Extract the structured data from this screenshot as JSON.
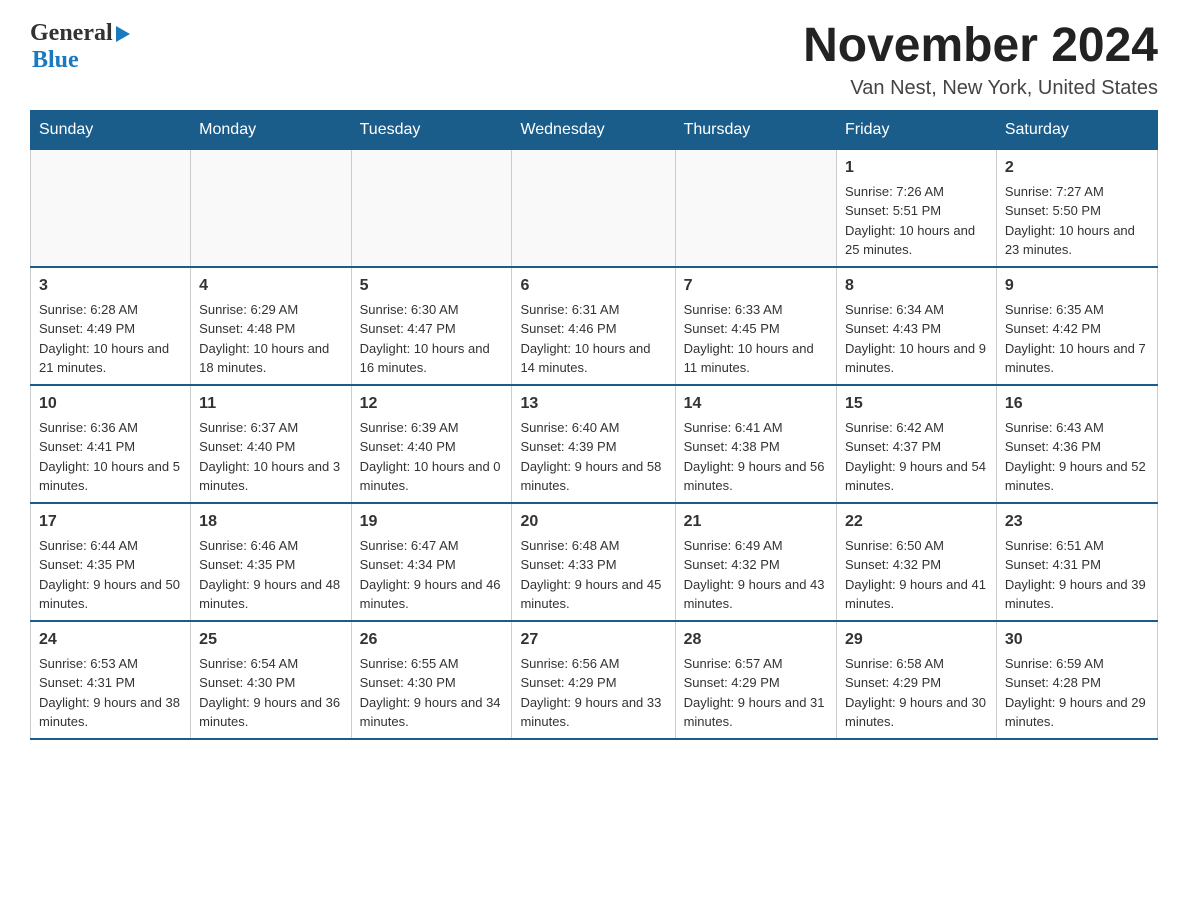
{
  "logo": {
    "general": "General",
    "blue": "Blue",
    "arrow_color": "#1a7abf"
  },
  "title": {
    "month_year": "November 2024",
    "location": "Van Nest, New York, United States"
  },
  "header_days": [
    "Sunday",
    "Monday",
    "Tuesday",
    "Wednesday",
    "Thursday",
    "Friday",
    "Saturday"
  ],
  "weeks": [
    [
      {
        "day": "",
        "sunrise": "",
        "sunset": "",
        "daylight": ""
      },
      {
        "day": "",
        "sunrise": "",
        "sunset": "",
        "daylight": ""
      },
      {
        "day": "",
        "sunrise": "",
        "sunset": "",
        "daylight": ""
      },
      {
        "day": "",
        "sunrise": "",
        "sunset": "",
        "daylight": ""
      },
      {
        "day": "",
        "sunrise": "",
        "sunset": "",
        "daylight": ""
      },
      {
        "day": "1",
        "sunrise": "Sunrise: 7:26 AM",
        "sunset": "Sunset: 5:51 PM",
        "daylight": "Daylight: 10 hours and 25 minutes."
      },
      {
        "day": "2",
        "sunrise": "Sunrise: 7:27 AM",
        "sunset": "Sunset: 5:50 PM",
        "daylight": "Daylight: 10 hours and 23 minutes."
      }
    ],
    [
      {
        "day": "3",
        "sunrise": "Sunrise: 6:28 AM",
        "sunset": "Sunset: 4:49 PM",
        "daylight": "Daylight: 10 hours and 21 minutes."
      },
      {
        "day": "4",
        "sunrise": "Sunrise: 6:29 AM",
        "sunset": "Sunset: 4:48 PM",
        "daylight": "Daylight: 10 hours and 18 minutes."
      },
      {
        "day": "5",
        "sunrise": "Sunrise: 6:30 AM",
        "sunset": "Sunset: 4:47 PM",
        "daylight": "Daylight: 10 hours and 16 minutes."
      },
      {
        "day": "6",
        "sunrise": "Sunrise: 6:31 AM",
        "sunset": "Sunset: 4:46 PM",
        "daylight": "Daylight: 10 hours and 14 minutes."
      },
      {
        "day": "7",
        "sunrise": "Sunrise: 6:33 AM",
        "sunset": "Sunset: 4:45 PM",
        "daylight": "Daylight: 10 hours and 11 minutes."
      },
      {
        "day": "8",
        "sunrise": "Sunrise: 6:34 AM",
        "sunset": "Sunset: 4:43 PM",
        "daylight": "Daylight: 10 hours and 9 minutes."
      },
      {
        "day": "9",
        "sunrise": "Sunrise: 6:35 AM",
        "sunset": "Sunset: 4:42 PM",
        "daylight": "Daylight: 10 hours and 7 minutes."
      }
    ],
    [
      {
        "day": "10",
        "sunrise": "Sunrise: 6:36 AM",
        "sunset": "Sunset: 4:41 PM",
        "daylight": "Daylight: 10 hours and 5 minutes."
      },
      {
        "day": "11",
        "sunrise": "Sunrise: 6:37 AM",
        "sunset": "Sunset: 4:40 PM",
        "daylight": "Daylight: 10 hours and 3 minutes."
      },
      {
        "day": "12",
        "sunrise": "Sunrise: 6:39 AM",
        "sunset": "Sunset: 4:40 PM",
        "daylight": "Daylight: 10 hours and 0 minutes."
      },
      {
        "day": "13",
        "sunrise": "Sunrise: 6:40 AM",
        "sunset": "Sunset: 4:39 PM",
        "daylight": "Daylight: 9 hours and 58 minutes."
      },
      {
        "day": "14",
        "sunrise": "Sunrise: 6:41 AM",
        "sunset": "Sunset: 4:38 PM",
        "daylight": "Daylight: 9 hours and 56 minutes."
      },
      {
        "day": "15",
        "sunrise": "Sunrise: 6:42 AM",
        "sunset": "Sunset: 4:37 PM",
        "daylight": "Daylight: 9 hours and 54 minutes."
      },
      {
        "day": "16",
        "sunrise": "Sunrise: 6:43 AM",
        "sunset": "Sunset: 4:36 PM",
        "daylight": "Daylight: 9 hours and 52 minutes."
      }
    ],
    [
      {
        "day": "17",
        "sunrise": "Sunrise: 6:44 AM",
        "sunset": "Sunset: 4:35 PM",
        "daylight": "Daylight: 9 hours and 50 minutes."
      },
      {
        "day": "18",
        "sunrise": "Sunrise: 6:46 AM",
        "sunset": "Sunset: 4:35 PM",
        "daylight": "Daylight: 9 hours and 48 minutes."
      },
      {
        "day": "19",
        "sunrise": "Sunrise: 6:47 AM",
        "sunset": "Sunset: 4:34 PM",
        "daylight": "Daylight: 9 hours and 46 minutes."
      },
      {
        "day": "20",
        "sunrise": "Sunrise: 6:48 AM",
        "sunset": "Sunset: 4:33 PM",
        "daylight": "Daylight: 9 hours and 45 minutes."
      },
      {
        "day": "21",
        "sunrise": "Sunrise: 6:49 AM",
        "sunset": "Sunset: 4:32 PM",
        "daylight": "Daylight: 9 hours and 43 minutes."
      },
      {
        "day": "22",
        "sunrise": "Sunrise: 6:50 AM",
        "sunset": "Sunset: 4:32 PM",
        "daylight": "Daylight: 9 hours and 41 minutes."
      },
      {
        "day": "23",
        "sunrise": "Sunrise: 6:51 AM",
        "sunset": "Sunset: 4:31 PM",
        "daylight": "Daylight: 9 hours and 39 minutes."
      }
    ],
    [
      {
        "day": "24",
        "sunrise": "Sunrise: 6:53 AM",
        "sunset": "Sunset: 4:31 PM",
        "daylight": "Daylight: 9 hours and 38 minutes."
      },
      {
        "day": "25",
        "sunrise": "Sunrise: 6:54 AM",
        "sunset": "Sunset: 4:30 PM",
        "daylight": "Daylight: 9 hours and 36 minutes."
      },
      {
        "day": "26",
        "sunrise": "Sunrise: 6:55 AM",
        "sunset": "Sunset: 4:30 PM",
        "daylight": "Daylight: 9 hours and 34 minutes."
      },
      {
        "day": "27",
        "sunrise": "Sunrise: 6:56 AM",
        "sunset": "Sunset: 4:29 PM",
        "daylight": "Daylight: 9 hours and 33 minutes."
      },
      {
        "day": "28",
        "sunrise": "Sunrise: 6:57 AM",
        "sunset": "Sunset: 4:29 PM",
        "daylight": "Daylight: 9 hours and 31 minutes."
      },
      {
        "day": "29",
        "sunrise": "Sunrise: 6:58 AM",
        "sunset": "Sunset: 4:29 PM",
        "daylight": "Daylight: 9 hours and 30 minutes."
      },
      {
        "day": "30",
        "sunrise": "Sunrise: 6:59 AM",
        "sunset": "Sunset: 4:28 PM",
        "daylight": "Daylight: 9 hours and 29 minutes."
      }
    ]
  ]
}
